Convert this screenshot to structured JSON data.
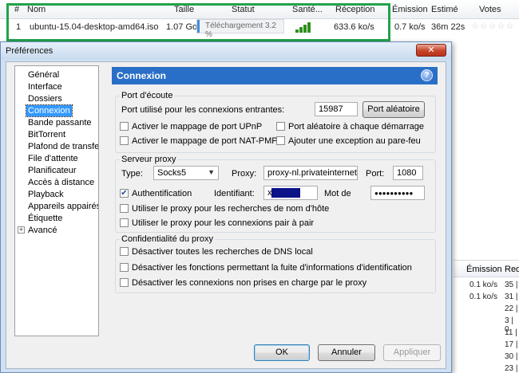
{
  "torrent_list": {
    "columns": {
      "num": "#",
      "name": "Nom",
      "size": "Taille",
      "status": "Statut",
      "health": "Santé...",
      "download": "Réception",
      "upload": "Émission",
      "eta": "Estimé",
      "votes": "Votes"
    },
    "row": {
      "num": "1",
      "name": "ubuntu-15.04-desktop-amd64.iso",
      "size": "1.07 Go",
      "status": "Téléchargement 3.2 %",
      "progress": 0.032,
      "download": "633.6 ko/s",
      "upload": "0.7 ko/s",
      "eta": "36m 22s",
      "votes": "☆☆☆☆☆"
    },
    "highlight_color": "#22a34a"
  },
  "peer_list": {
    "columns": {
      "upload": "Émission",
      "req": "Req"
    },
    "rows": [
      {
        "upload": "0.1 ko/s",
        "req": "35 |"
      },
      {
        "upload": "0.1 ko/s",
        "req": "31 |"
      },
      {
        "upload": "",
        "req": "22 |"
      },
      {
        "upload": "",
        "req": "3 | 0"
      },
      {
        "upload": "",
        "req": "11 |"
      },
      {
        "upload": "",
        "req": "17 |"
      },
      {
        "upload": "",
        "req": "30 |"
      },
      {
        "upload": "",
        "req": "23 |"
      }
    ]
  },
  "dialog": {
    "title": "Préférences",
    "close_glyph": "✕",
    "tree": [
      {
        "label": "Général"
      },
      {
        "label": "Interface"
      },
      {
        "label": "Dossiers"
      },
      {
        "label": "Connexion",
        "selected": true
      },
      {
        "label": "Bande passante"
      },
      {
        "label": "BitTorrent"
      },
      {
        "label": "Plafond de transfert"
      },
      {
        "label": "File d'attente"
      },
      {
        "label": "Planificateur"
      },
      {
        "label": "Accès à distance"
      },
      {
        "label": "Playback"
      },
      {
        "label": "Appareils appairés"
      },
      {
        "label": "Étiquette"
      },
      {
        "label": "Avancé",
        "expandable": true
      }
    ],
    "expander_glyph": "+",
    "section_title": "Connexion",
    "help_glyph": "?",
    "listen_port": {
      "group_title": "Port d'écoute",
      "port_label": "Port utilisé pour les connexions entrantes:",
      "port_value": "15987",
      "random_port_button": "Port aléatoire",
      "upnp": {
        "label": "Activer le mappage de port UPnP",
        "checked": false
      },
      "random_each_start": {
        "label": "Port aléatoire à chaque démarrage",
        "checked": false
      },
      "nat_pmp": {
        "label": "Activer le mappage de port NAT-PMP",
        "checked": false
      },
      "firewall_exception": {
        "label": "Ajouter une exception au pare-feu",
        "checked": false
      }
    },
    "proxy": {
      "group_title": "Serveur proxy",
      "type_label": "Type:",
      "type_value": "Socks5",
      "proxy_label": "Proxy:",
      "proxy_value": "proxy-nl.privateinternetac",
      "port_label": "Port:",
      "port_value": "1080",
      "auth": {
        "label": "Authentification",
        "checked": true
      },
      "username_label": "Identifiant:",
      "username_value": "x",
      "password_label": "Mot de",
      "password_value": "●●●●●●●●●●",
      "hostname_lookups": {
        "label": "Utiliser le proxy pour les recherches de nom d'hôte",
        "checked": false
      },
      "p2p_connections": {
        "label": "Utiliser le proxy pour les connexions pair à pair",
        "checked": false
      }
    },
    "privacy": {
      "group_title": "Confidentialité du proxy",
      "disable_dns": {
        "label": "Désactiver toutes les recherches de DNS local",
        "checked": false
      },
      "disable_leaks": {
        "label": "Désactiver les fonctions permettant la fuite d'informations d'identification",
        "checked": false
      },
      "disable_unsupported": {
        "label": "Désactiver les connexions non prises en charge par le proxy",
        "checked": false
      }
    },
    "buttons": {
      "ok": "OK",
      "cancel": "Annuler",
      "apply": "Appliquer"
    },
    "check_glyph": "✔"
  }
}
